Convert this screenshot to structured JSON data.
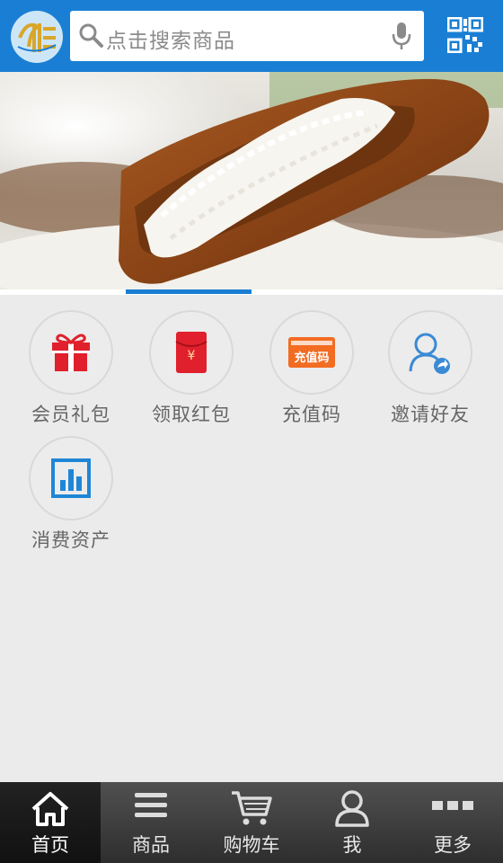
{
  "search": {
    "placeholder": "点击搜索商品"
  },
  "menu": [
    {
      "label": "会员礼包",
      "icon": "gift-icon"
    },
    {
      "label": "领取红包",
      "icon": "red-envelope-icon"
    },
    {
      "label": "充值码",
      "icon": "recharge-code-icon"
    },
    {
      "label": "邀请好友",
      "icon": "invite-friend-icon"
    },
    {
      "label": "消费资产",
      "icon": "consumption-chart-icon"
    }
  ],
  "recharge_card_text": "充值码",
  "nav": [
    {
      "label": "首页",
      "icon": "home-icon"
    },
    {
      "label": "商品",
      "icon": "list-icon"
    },
    {
      "label": "购物车",
      "icon": "cart-icon"
    },
    {
      "label": "我",
      "icon": "user-icon"
    },
    {
      "label": "更多",
      "icon": "more-icon"
    }
  ],
  "colors": {
    "brand_blue": "#1a7fd4",
    "accent_red": "#e0202c",
    "accent_orange": "#f26c22",
    "nav_bg": "#3a3a3a"
  }
}
